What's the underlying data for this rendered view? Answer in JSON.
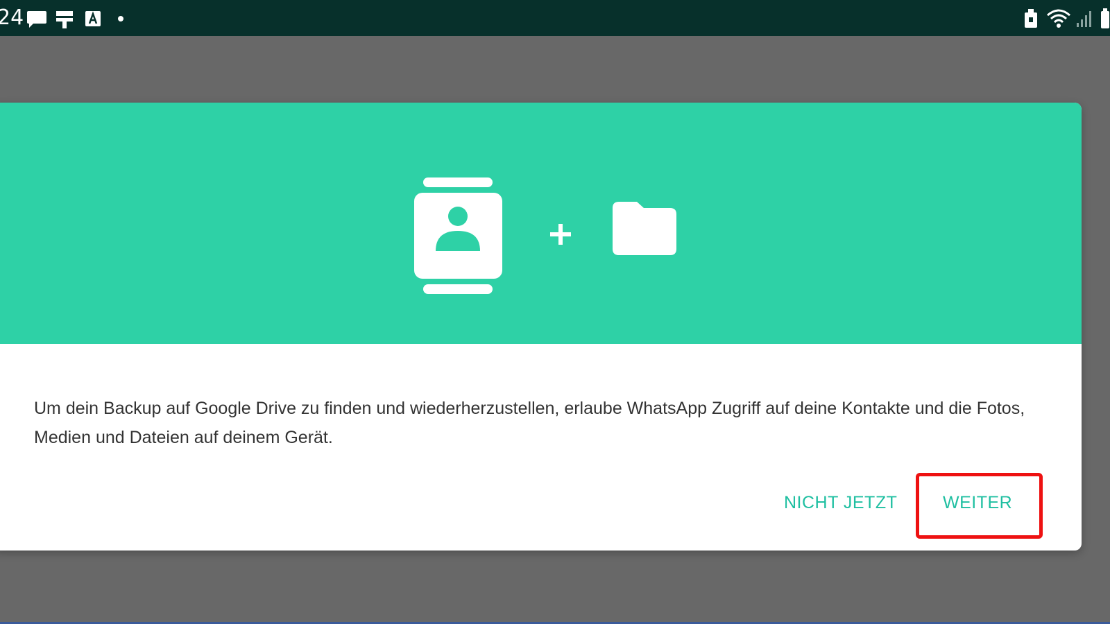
{
  "status_bar": {
    "time": "24",
    "icons": [
      "message-icon",
      "tools-icon",
      "keyboard-icon",
      "dot-icon",
      "lock-icon",
      "wifi-icon",
      "signal-icon",
      "battery-icon"
    ]
  },
  "dialog": {
    "illustration": {
      "icons": [
        "contacts-icon",
        "plus-icon",
        "folder-icon"
      ],
      "header_color": "#2ed1a6"
    },
    "message": "Um dein Backup auf Google Drive zu finden und wiederherzustellen, erlaube WhatsApp Zugriff auf deine Kontakte und die Fotos, Medien und Dateien auf deinem Gerät.",
    "buttons": {
      "not_now": "NICHT JETZT",
      "continue": "WEITER"
    },
    "accent_color": "#1fbfa1"
  },
  "highlight": {
    "color": "#ee1111"
  }
}
